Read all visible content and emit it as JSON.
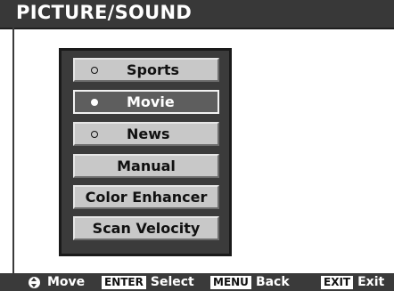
{
  "header": {
    "title": "PICTURE/SOUND"
  },
  "menu": {
    "items": [
      {
        "label": "Sports",
        "radio": "empty",
        "selected": false
      },
      {
        "label": "Movie",
        "radio": "filled",
        "selected": true
      },
      {
        "label": "News",
        "radio": "empty",
        "selected": false
      },
      {
        "label": "Manual",
        "radio": "none",
        "selected": false
      },
      {
        "label": "Color Enhancer",
        "radio": "none",
        "selected": false
      },
      {
        "label": "Scan Velocity",
        "radio": "none",
        "selected": false
      }
    ]
  },
  "footer": {
    "move": {
      "icon": "up-down-arrows-icon",
      "label": "Move"
    },
    "select": {
      "key": "ENTER",
      "label": "Select"
    },
    "back": {
      "key": "MENU",
      "label": "Back"
    },
    "exit": {
      "key": "EXIT",
      "label": "Exit"
    }
  },
  "colors": {
    "title_bar": "#383838",
    "menu_panel": "#3b3b3b",
    "item_normal": "#c8c8c8",
    "item_selected": "#5e5e5e"
  }
}
